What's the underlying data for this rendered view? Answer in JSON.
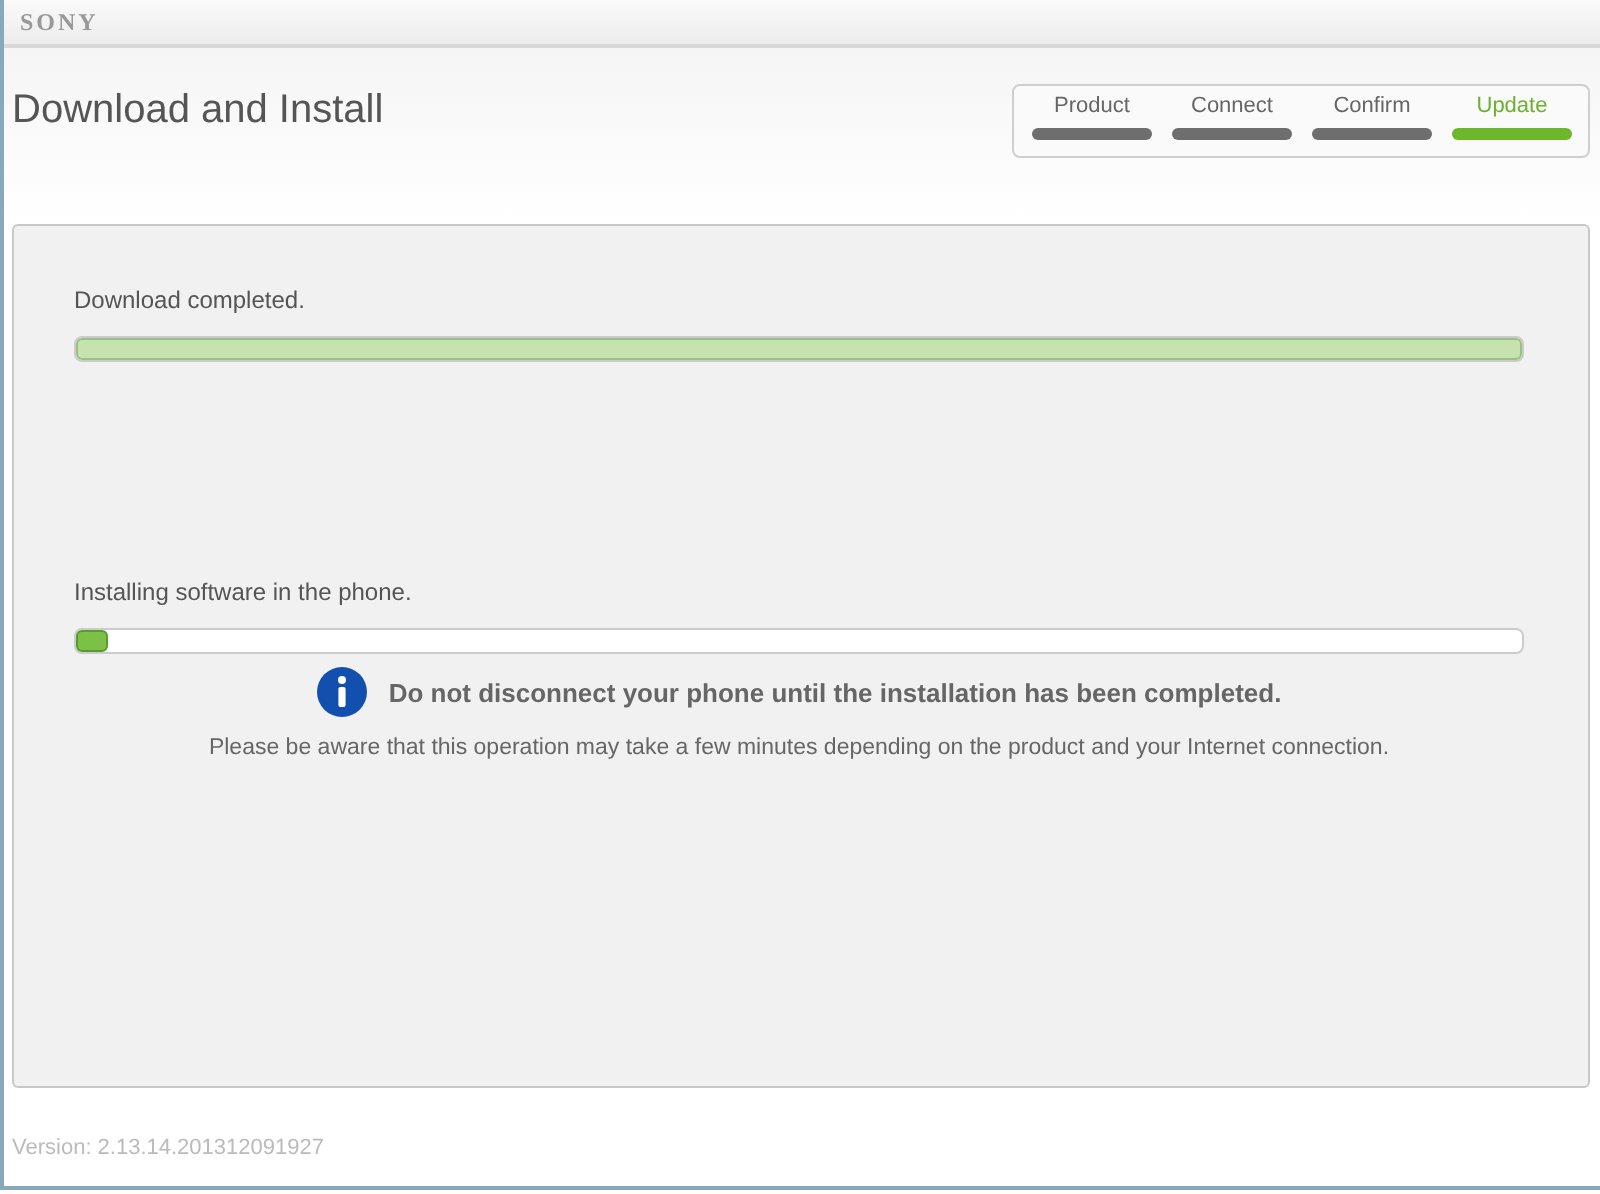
{
  "brand": "SONY",
  "page": {
    "title": "Download and Install"
  },
  "steps": [
    {
      "label": "Product",
      "selected": false
    },
    {
      "label": "Connect",
      "selected": false
    },
    {
      "label": "Confirm",
      "selected": false
    },
    {
      "label": "Update",
      "selected": true
    }
  ],
  "tasks": [
    {
      "label": "Download completed.",
      "level": 1,
      "complete": true
    },
    {
      "label": "Installing software in the phone.",
      "level": 0.02,
      "complete": false
    }
  ],
  "notice": {
    "headline": "Do not disconnect your phone until the installation has been completed.",
    "detail": "Please be aware that this operation may take a few minutes depending on the product and your Internet connection."
  },
  "version": "Version: 2.13.14.201312091927"
}
